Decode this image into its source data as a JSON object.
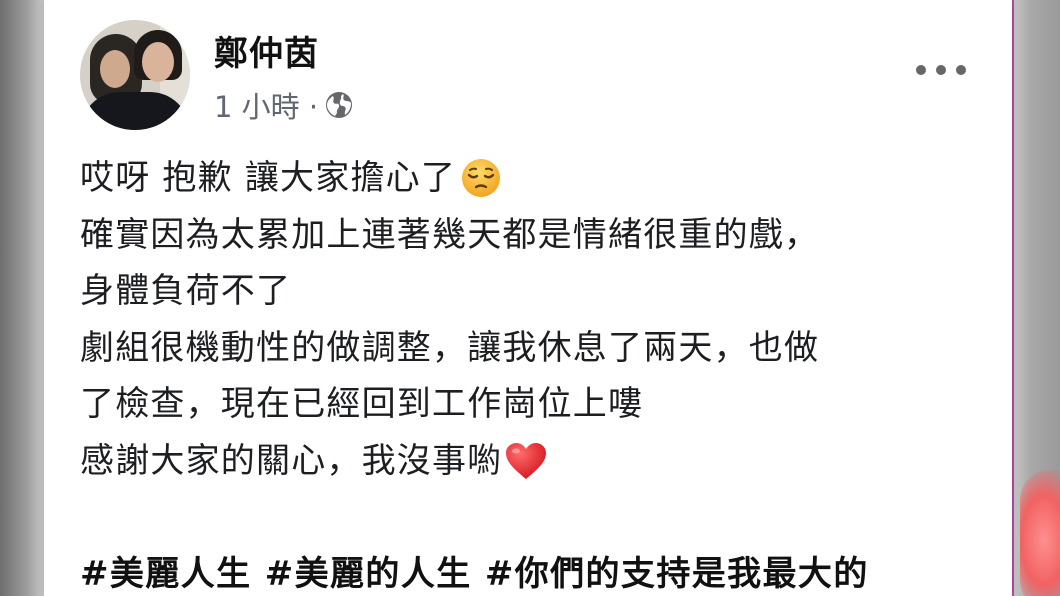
{
  "post": {
    "author": "鄭仲茵",
    "timestamp": "1 小時 ·",
    "privacy_icon": "globe-icon",
    "menu_icon": "more-options-icon",
    "lines": [
      "哎呀 抱歉 讓大家擔心了",
      "確實因為太累加上連著幾天都是情緒很重的戲，",
      "身體負荷不了",
      "劇組很機動性的做調整，讓我休息了兩天，也做",
      "了檢查，現在已經回到工作崗位上嘍",
      "感謝大家的關心，我沒事喲"
    ],
    "emoji_line1": "pensive-face-emoji",
    "emoji_line6": "red-heart-emoji",
    "hashtags": "#美麗人生 #美麗的人生 #你們的支持是我最大的"
  },
  "colors": {
    "text": "#1c1e21",
    "meta": "#606770",
    "heart": "#e0262b",
    "emoji_face": "#f6b93b"
  }
}
